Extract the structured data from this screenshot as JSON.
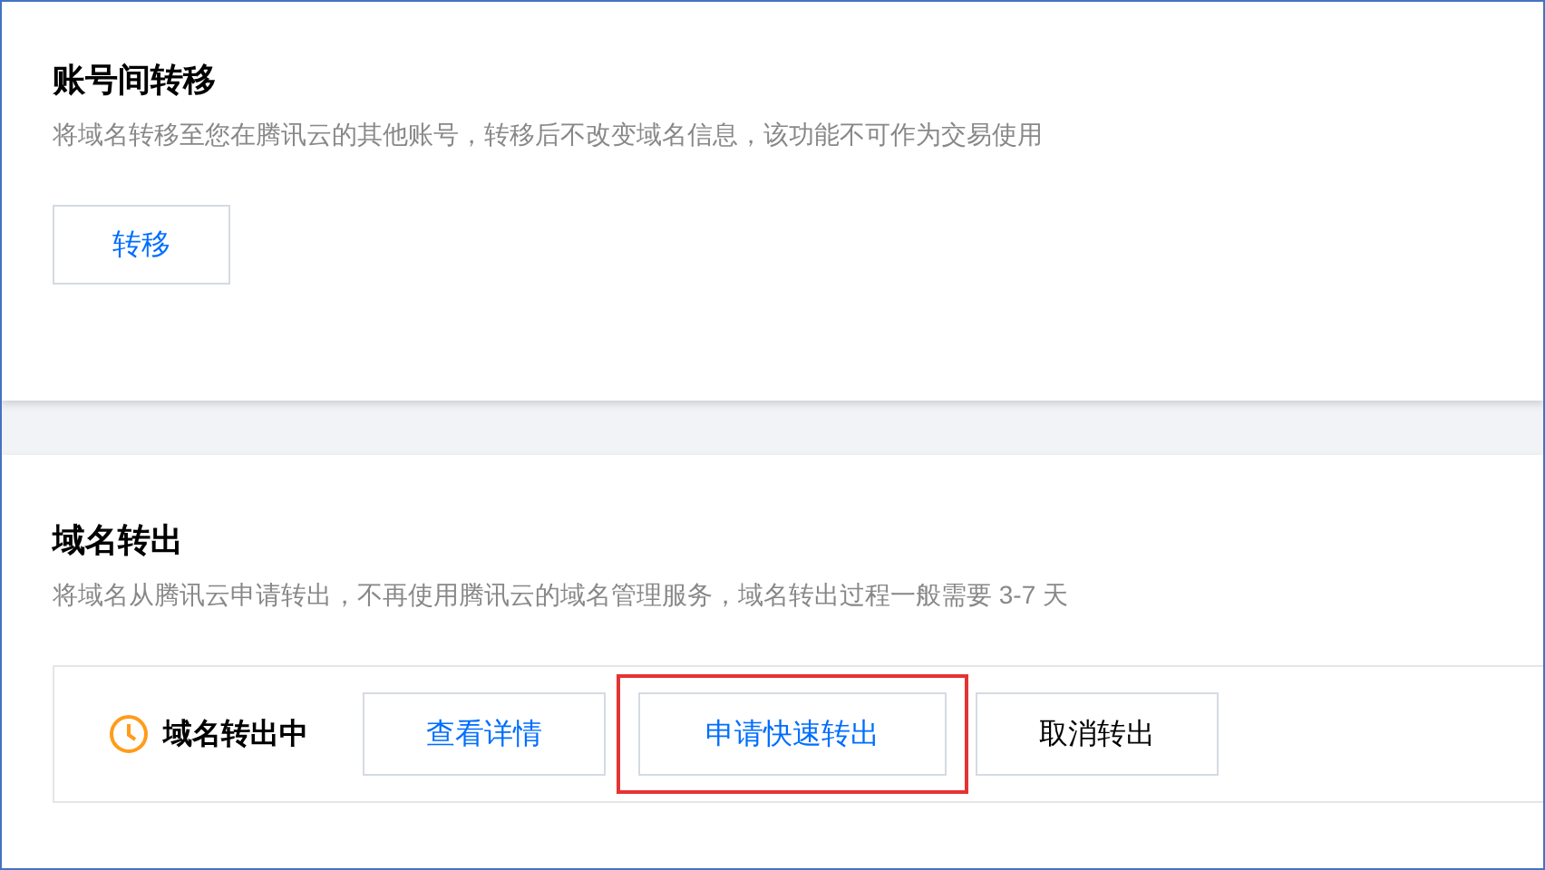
{
  "sections": [
    {
      "title": "账号间转移",
      "description": "将域名转移至您在腾讯云的其他账号，转移后不改变域名信息，该功能不可作为交易使用",
      "buttons": [
        {
          "label": "转移",
          "kind": "link",
          "highlighted": false
        }
      ]
    },
    {
      "title": "域名转出",
      "description": "将域名从腾讯云申请转出，不再使用腾讯云的域名管理服务，域名转出过程一般需要 3-7 天",
      "status": {
        "label": "域名转出中",
        "kind": "pending"
      },
      "buttons": [
        {
          "label": "查看详情",
          "kind": "link",
          "highlighted": false
        },
        {
          "label": "申请快速转出",
          "kind": "link",
          "highlighted": true
        },
        {
          "label": "取消转出",
          "kind": "default",
          "highlighted": false
        }
      ]
    }
  ]
}
